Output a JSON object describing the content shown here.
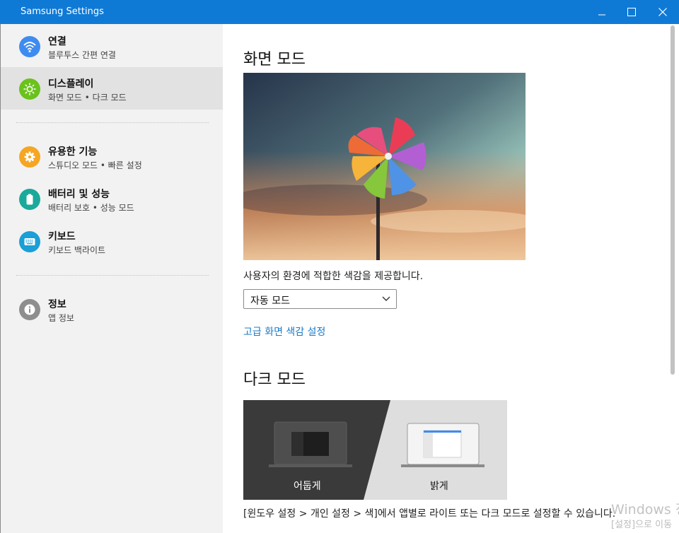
{
  "window": {
    "title": "Samsung Settings"
  },
  "sidebar": {
    "items": [
      {
        "title": "연결",
        "subtitle": "블루투스 간편 연결",
        "icon": "wifi-icon",
        "color": "#3f8cf0"
      },
      {
        "title": "디스플레이",
        "subtitle": "화면 모드  •  다크 모드",
        "icon": "brightness-icon",
        "color": "#6ac21c"
      },
      {
        "title": "유용한 기능",
        "subtitle": "스튜디오 모드  •  빠른 설정",
        "icon": "gear-icon",
        "color": "#f5a623"
      },
      {
        "title": "배터리 및 성능",
        "subtitle": "배터리 보호  •  성능 모드",
        "icon": "battery-icon",
        "color": "#1aa99a"
      },
      {
        "title": "키보드",
        "subtitle": "키보드 백라이트",
        "icon": "keyboard-icon",
        "color": "#1a9fd6"
      },
      {
        "title": "정보",
        "subtitle": "앱 정보",
        "icon": "info-icon",
        "color": "#8e8e8e"
      }
    ]
  },
  "main": {
    "screen_mode": {
      "heading": "화면 모드",
      "description": "사용자의 환경에 적합한 색감을 제공합니다.",
      "select_value": "자동 모드",
      "advanced_link": "고급 화면 색감 설정"
    },
    "dark_mode": {
      "heading": "다크 모드",
      "option_dark": "어둡게",
      "option_light": "밝게",
      "footer": "[윈도우 설정 > 개인 설정 > 색]에서 앱별로 라이트 또는 다크 모드로 설정할 수 있습니다."
    }
  },
  "watermark": {
    "line1": "Windows 정",
    "line2": "[설정]으로 이동"
  },
  "colors": {
    "titlebar": "#0f7ad6",
    "link": "#1a7ac7",
    "active_item": "#e2e2e2"
  }
}
